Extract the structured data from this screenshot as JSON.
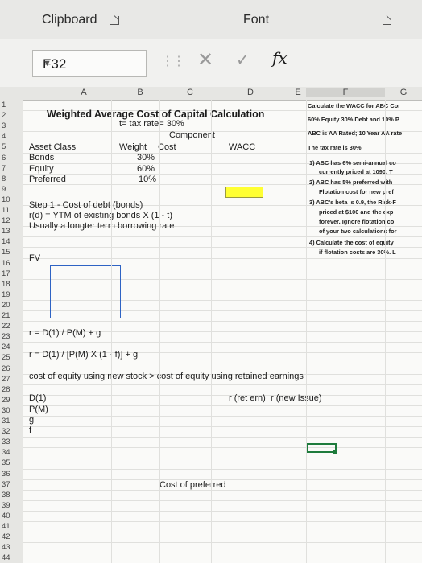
{
  "ribbon": {
    "clipboard": "Clipboard",
    "font": "Font"
  },
  "formula_bar": {
    "name_box": "F32",
    "cancel_glyph": "✕",
    "enter_glyph": "✓",
    "fx": "fx",
    "value": ""
  },
  "columns": [
    "A",
    "B",
    "C",
    "D",
    "E",
    "F",
    "G"
  ],
  "selected_column": "F",
  "rows": [
    "1",
    "2",
    "3",
    "4",
    "5",
    "6",
    "7",
    "8",
    "9",
    "10",
    "11",
    "12",
    "13",
    "14",
    "15",
    "16",
    "17",
    "18",
    "19",
    "20",
    "21",
    "22",
    "23",
    "24",
    "25",
    "26",
    "27",
    "28",
    "29",
    "30",
    "31",
    "32",
    "33",
    "34",
    "35",
    "36",
    "37",
    "38",
    "39",
    "40",
    "41",
    "42",
    "43",
    "44"
  ],
  "cells": {
    "title": "Weighted Average Cost of Capital Calculation",
    "tax_line": "t= tax rate= 30%",
    "component": "Component",
    "asset_class": "Asset Class",
    "weight": "Weight",
    "cost": "Cost",
    "wacc": "WACC",
    "bonds": "Bonds",
    "bonds_w": "30%",
    "equity": "Equity",
    "equity_w": "60%",
    "preferred": "Preferred",
    "preferred_w": "10%",
    "step1": "Step 1 - Cost of debt (bonds)",
    "rd": "r(d) = YTM of existing bonds X (1 - t)",
    "longer": "Usually a longter term borrowing rate",
    "fv": "FV",
    "formula1": "r = D(1) / P(M) + g",
    "formula2": "r = D(1) / [P(M) X (1 - f)] + g",
    "equity_compare": "cost of equity using new stock > cost of equity using retained earnings",
    "d1": "D(1)",
    "ret_ern": "r (ret ern)",
    "new_issue": "r (new Issue)",
    "pm": "P(M)",
    "g": "g",
    "f": "f",
    "cost_pref": "Cost of preferred"
  },
  "notes": {
    "n1": "Calculate the WACC for ABC Cor",
    "n2": "60% Equity 30% Debt and 10% P",
    "n3": "ABC is AA Rated; 10 Year AA rate",
    "n4": "The tax rate is 30%",
    "n5a": "1) ABC has 6% semi-annual co",
    "n5b": "currently priced at 1090. T",
    "n6a": "2) ABC has 5% preferred with",
    "n6b": "Flotation cost for new pref",
    "n7a": "3) ABC's beta is 0.9, the Risk-F",
    "n7b": "priced at $100 and the exp",
    "n7c": "forever. Ignore flotation co",
    "n7d": "of your two calculations for",
    "n8a": "4) Calculate the cost of equity",
    "n8b": "if flotation costs are 30%. L"
  },
  "colors": {
    "selection": "#1e7b3c",
    "highlight": "#ffff33",
    "box": "#2e63c4"
  }
}
